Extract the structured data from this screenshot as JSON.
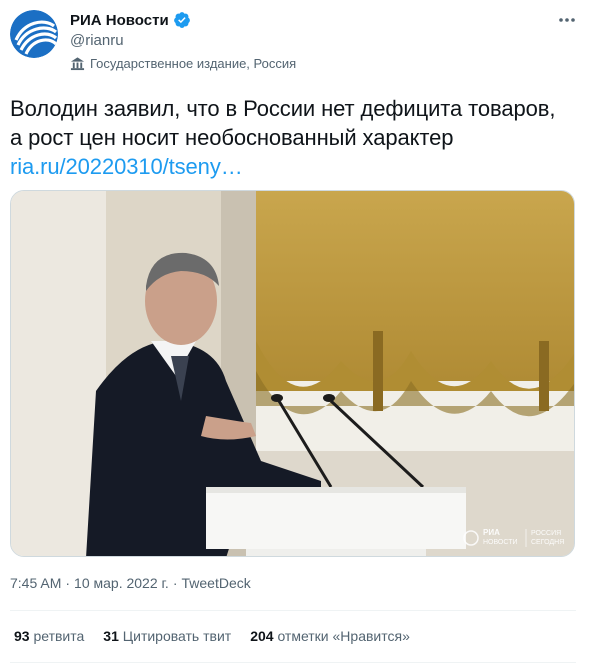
{
  "colors": {
    "accent": "#1d9bf0",
    "text": "#0f1419",
    "muted": "#536471"
  },
  "author": {
    "name": "РИА Новости",
    "handle": "@rianru",
    "verified_icon": "verified-badge-icon",
    "label": "Государственное издание, Россия",
    "label_icon": "state-media-icon"
  },
  "tweet": {
    "line1": "Володин заявил, что в России нет дефицита товаров,",
    "line2": "а рост цен носит необоснованный характер",
    "link": "ria.ru/20220310/tseny…"
  },
  "media": {
    "watermark_line1": "РИА",
    "watermark_line2": "НОВОСТИ",
    "watermark_line3": "РОССИЯ",
    "watermark_line4": "СЕГОДНЯ"
  },
  "meta": {
    "time": "7:45 AM",
    "separator1": "·",
    "date": "10 мар. 2022 г.",
    "separator2": "·",
    "source": "TweetDeck"
  },
  "stats": {
    "retweets_count": "93",
    "retweets_label": "ретвита",
    "quotes_count": "31",
    "quotes_label": "Цитировать твит",
    "likes_count": "204",
    "likes_label": "отметки «Нравится»"
  }
}
